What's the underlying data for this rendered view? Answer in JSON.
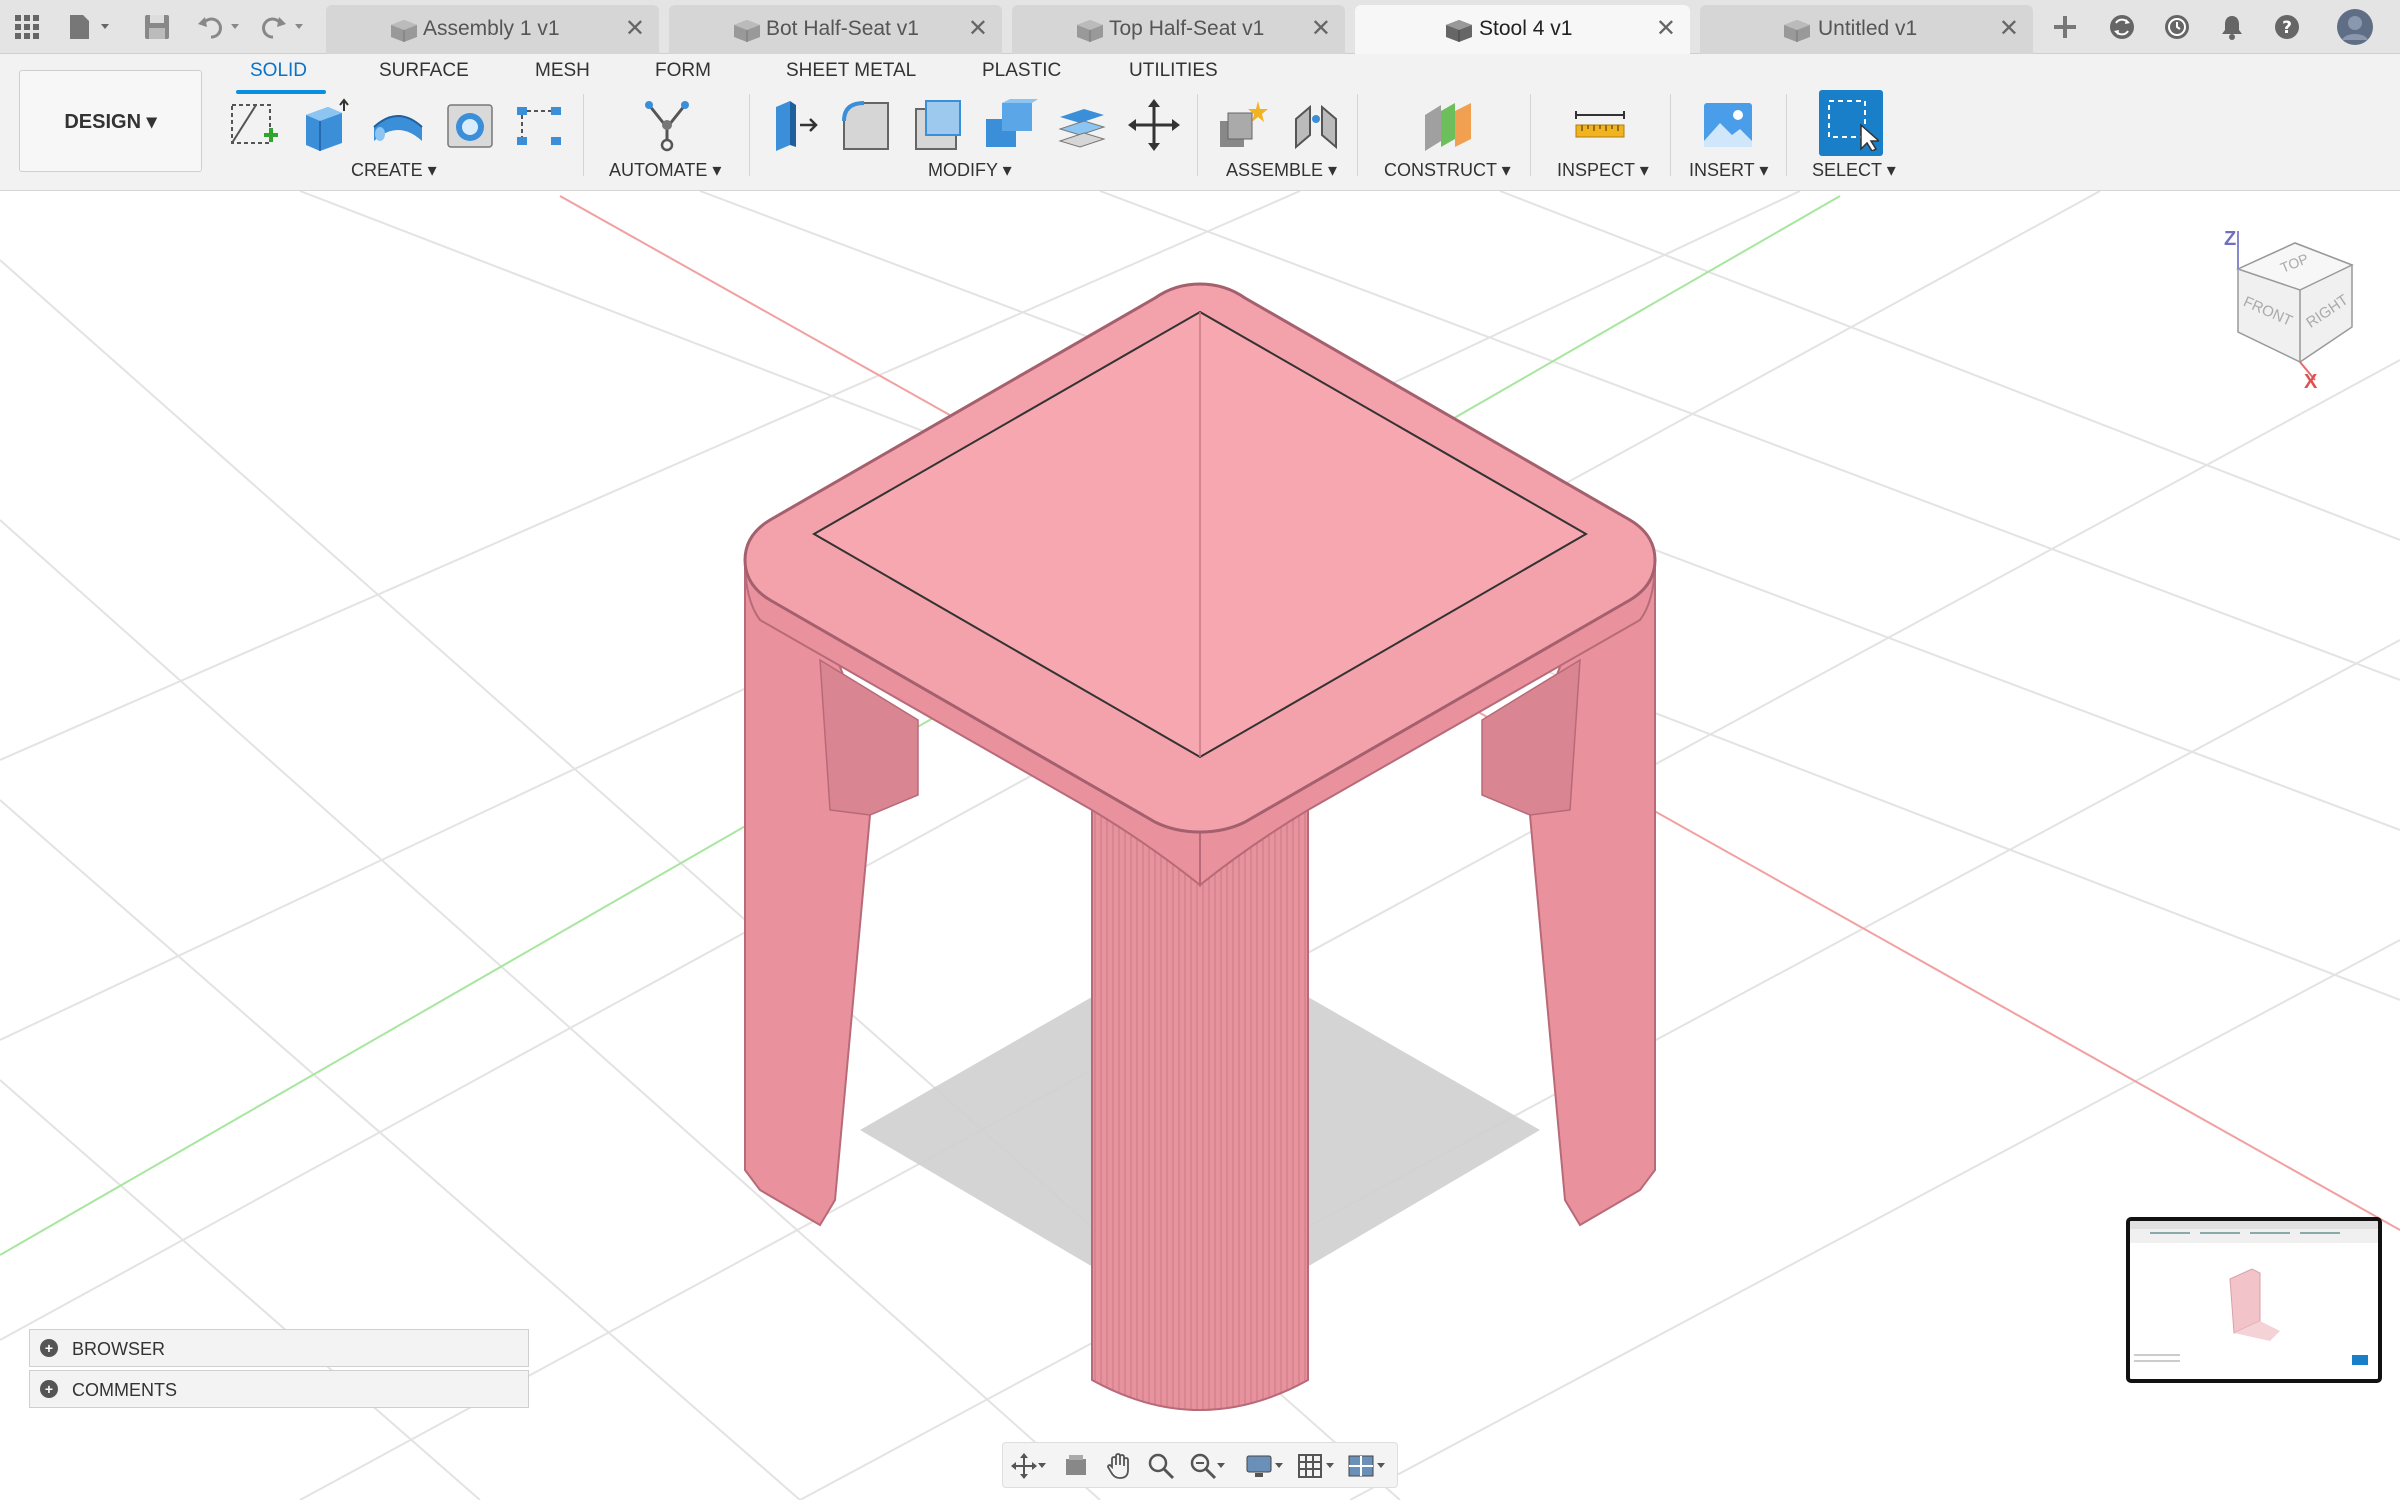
{
  "tabs": [
    {
      "label": "Assembly 1 v1",
      "active": false
    },
    {
      "label": "Bot Half-Seat v1",
      "active": false
    },
    {
      "label": "Top Half-Seat v1",
      "active": false
    },
    {
      "label": "Stool 4 v1",
      "active": true
    },
    {
      "label": "Untitled v1",
      "active": false
    }
  ],
  "tab_close_glyph": "✕",
  "workspace_button": "DESIGN ▾",
  "workspace_tabs": [
    "SOLID",
    "SURFACE",
    "MESH",
    "FORM",
    "SHEET METAL",
    "PLASTIC",
    "UTILITIES"
  ],
  "active_workspace_tab": "SOLID",
  "tool_groups": [
    "CREATE ▾",
    "AUTOMATE ▾",
    "MODIFY ▾",
    "ASSEMBLE ▾",
    "CONSTRUCT ▾",
    "INSPECT ▾",
    "INSERT ▾",
    "SELECT ▾"
  ],
  "viewcube": {
    "top": "TOP",
    "front": "FRONT",
    "right": "RIGHT",
    "axis_z": "Z",
    "axis_x": "X"
  },
  "panels": {
    "browser": "BROWSER",
    "comments": "COMMENTS"
  },
  "colors": {
    "model_face": "#f7a7b0",
    "model_side": "#e98f9b",
    "accent": "#0a8ee0",
    "select_active": "#1a7fc9",
    "axis_red": "#f2a0a0",
    "axis_green": "#a8e6a0"
  },
  "icons": {
    "app_menu": "grid-icon",
    "file": "file-icon",
    "save": "save-icon",
    "undo": "undo-icon",
    "redo": "redo-icon",
    "new_tab": "plus-icon",
    "extensions": "extensions-icon",
    "job_status": "clock-icon",
    "notifications": "bell-icon",
    "help": "help-icon",
    "account": "user-avatar-icon"
  }
}
